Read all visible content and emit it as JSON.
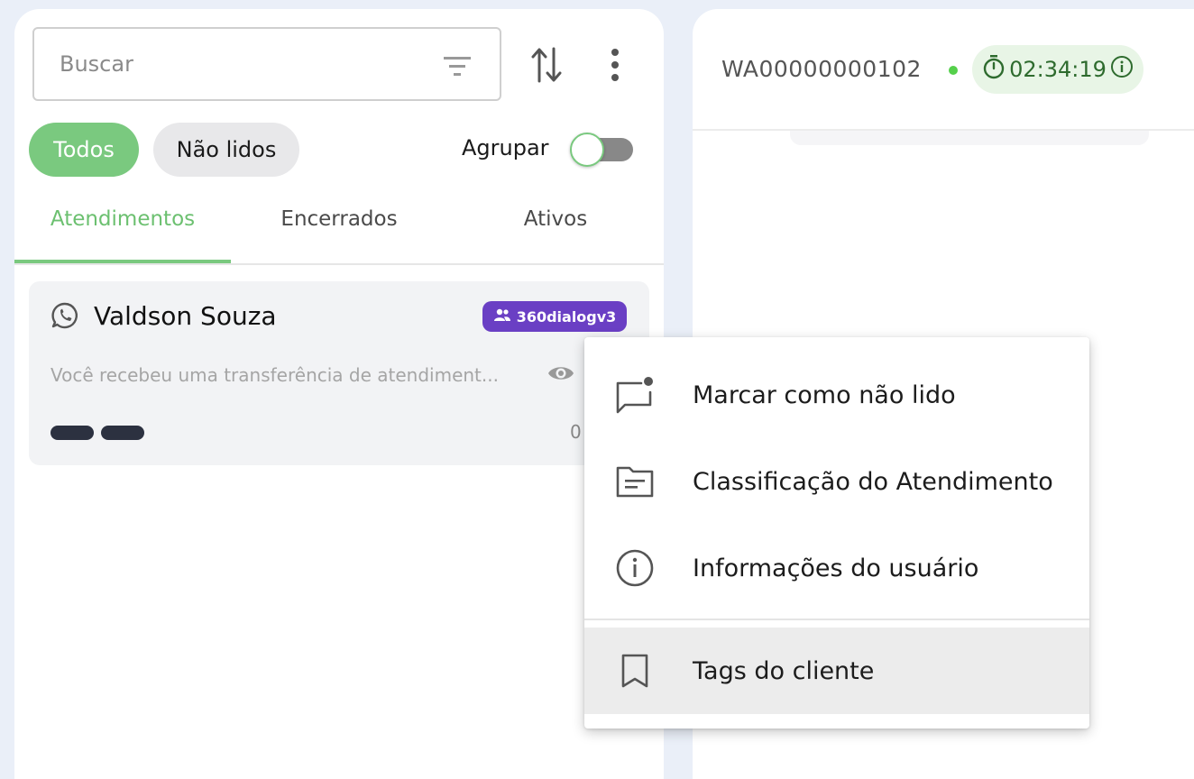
{
  "sidebar": {
    "search": {
      "placeholder": "Buscar"
    },
    "chips": {
      "all": "Todos",
      "unread": "Não lidos"
    },
    "group_toggle": {
      "label": "Agrupar"
    },
    "tabs": [
      {
        "label": "Atendimentos"
      },
      {
        "label": "Encerrados"
      },
      {
        "label": "Ativos"
      }
    ],
    "conversation": {
      "name": "Valdson Souza",
      "channel_badge": "360dialogv3",
      "preview": "Você recebeu uma transferência de atendiment...",
      "time": "0"
    }
  },
  "chat_header": {
    "conversation_id": "WA00000000102",
    "timer": "02:34:19"
  },
  "context_menu": {
    "items": [
      {
        "label": "Marcar como não lido",
        "icon": "unread-message-icon"
      },
      {
        "label": "Classificação do Atendimento",
        "icon": "folder-icon"
      },
      {
        "label": "Informações do usuário",
        "icon": "info-icon"
      },
      {
        "label": "Tags do cliente",
        "icon": "bookmark-icon"
      }
    ]
  },
  "colors": {
    "accent": "#7ac97f",
    "badge": "#6a3fc4",
    "online": "#55d04b"
  }
}
